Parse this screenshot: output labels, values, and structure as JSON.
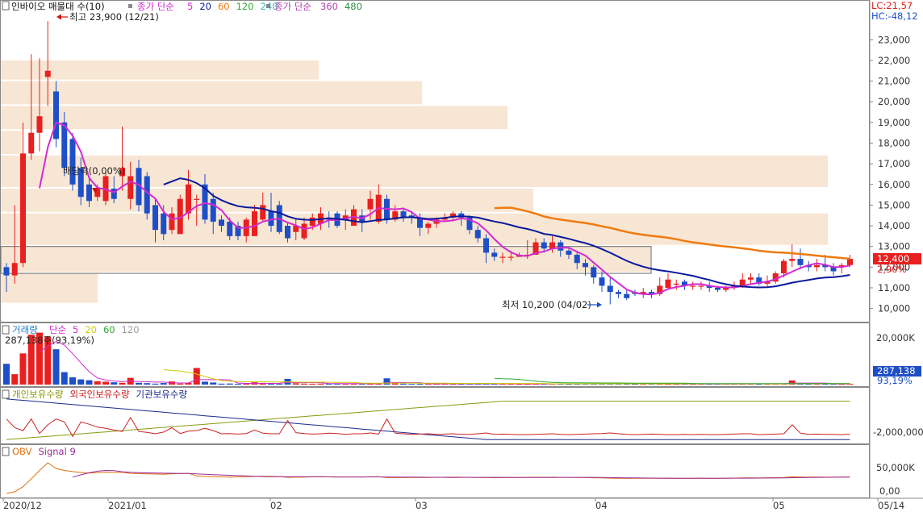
{
  "colors": {
    "up": "#e8201f",
    "down": "#1e4fc8",
    "ma5": "#d22ad2",
    "ma20": "#0a1a9c",
    "ma60": "#f07a10",
    "ma120": "#88bb22",
    "band": "#f7e6d3",
    "grid": "#aaaaaa",
    "axisText": "#333333"
  },
  "header": {
    "instrument": "인바이오 매물대 수(10)",
    "ma_label": "종가 단순",
    "ma_periods": [
      "5",
      "20",
      "60",
      "120",
      "240"
    ],
    "ma_colors": [
      "#d22ad2",
      "#0a1a9c",
      "#f07a10",
      "#33aa33",
      "#33bbbb"
    ],
    "ma2_label": "종가 단순",
    "ma2_periods": [
      "360",
      "480"
    ],
    "ma2_colors": [
      "#b040b0",
      "#2f8f4f"
    ]
  },
  "indicators": {
    "lc": "LC:21,57",
    "hc": "HC:-48,12"
  },
  "annotations": {
    "high": "최고 23,900 (12/21)",
    "low": "최저 10,200 (04/02)",
    "dividend": "배당락(0,00%)",
    "price_tag": "12,400",
    "pct_tag": "2,90%"
  },
  "volume": {
    "title": "거래량",
    "ma_label": "단순",
    "ma_periods": [
      "5",
      "20",
      "60",
      "120"
    ],
    "ma_colors": [
      "#d22ad2",
      "#cccc00",
      "#33aa33",
      "#999999"
    ],
    "summary": "287,138주(93,19%)",
    "tag_value": "287,138",
    "tag_pct": "93,19%",
    "axis_label": "20,000K"
  },
  "holdings": {
    "legend": [
      {
        "label": "개인보유수량",
        "color": "#8a9a10"
      },
      {
        "label": "외국인보유수량",
        "color": "#cc2222"
      },
      {
        "label": "기관보유수량",
        "color": "#1a2a8a"
      }
    ],
    "axis_label": "-2,000,000"
  },
  "obv": {
    "legend": [
      {
        "label": "OBV",
        "color": "#e07010"
      },
      {
        "label": "Signal 9",
        "color": "#9a2a9a"
      }
    ],
    "axis_labels": [
      "50,000K",
      "0,00"
    ]
  },
  "x_axis": {
    "labels": [
      "2020/12",
      "2021/01",
      "02",
      "03",
      "04",
      "05",
      "05/14"
    ]
  },
  "chart_data": {
    "type": "candlestick",
    "title": "인바이오",
    "y_ticks": [
      10000,
      11000,
      12000,
      13000,
      14000,
      15000,
      16000,
      17000,
      18000,
      19000,
      20000,
      21000,
      22000,
      23000
    ],
    "y_tick_labels": [
      "10,000",
      "11,000",
      "12,000",
      "13,000",
      "14,000",
      "15,000",
      "16,000",
      "17,000",
      "18,000",
      "19,000",
      "20,000",
      "21,000",
      "22,000",
      "23,000"
    ],
    "ylim": [
      9400,
      24300
    ],
    "dates": [
      "12/14",
      "12/15",
      "12/16",
      "12/17",
      "12/18",
      "12/21",
      "12/22",
      "12/23",
      "12/24",
      "12/28",
      "12/29",
      "12/30",
      "01/04",
      "01/05",
      "01/06",
      "01/07",
      "01/08",
      "01/11",
      "01/12",
      "01/13",
      "01/14",
      "01/15",
      "01/18",
      "01/19",
      "01/20",
      "01/21",
      "01/22",
      "01/25",
      "01/26",
      "01/27",
      "01/28",
      "01/29",
      "02/01",
      "02/02",
      "02/03",
      "02/04",
      "02/05",
      "02/08",
      "02/09",
      "02/10",
      "02/15",
      "02/16",
      "02/17",
      "02/18",
      "02/19",
      "02/22",
      "02/23",
      "02/24",
      "02/25",
      "02/26",
      "03/02",
      "03/03",
      "03/04",
      "03/05",
      "03/08",
      "03/09",
      "03/10",
      "03/11",
      "03/12",
      "03/15",
      "03/16",
      "03/17",
      "03/18",
      "03/19",
      "03/22",
      "03/23",
      "03/24",
      "03/25",
      "03/26",
      "03/29",
      "03/30",
      "03/31",
      "04/01",
      "04/02",
      "04/05",
      "04/06",
      "04/07",
      "04/08",
      "04/09",
      "04/12",
      "04/13",
      "04/14",
      "04/15",
      "04/16",
      "04/19",
      "04/20",
      "04/21",
      "04/22",
      "04/23",
      "04/26",
      "04/27",
      "04/28",
      "04/29",
      "04/30",
      "05/03",
      "05/04",
      "05/06",
      "05/07",
      "05/10",
      "05/11",
      "05/12",
      "05/13",
      "05/14"
    ],
    "open": [
      12000,
      11600,
      12200,
      17500,
      18500,
      21200,
      20500,
      19000,
      18200,
      16800,
      16000,
      15400,
      15200,
      15800,
      16400,
      15300,
      16800,
      16400,
      15000,
      14600,
      13800,
      13600,
      14600,
      15300,
      16000,
      15300,
      14300,
      14200,
      14000,
      13500,
      13500,
      14300,
      14700,
      15000,
      14000,
      13700,
      13400,
      14000,
      14100,
      14400,
      14600,
      14300,
      14000,
      14500,
      14800,
      14200,
      15300,
      14300,
      14700,
      14500,
      14400,
      13900,
      14100,
      14300,
      14400,
      14600,
      14400,
      13800,
      13400,
      12700,
      12500,
      12500,
      12500,
      12600,
      12600,
      13200,
      12900,
      13200,
      12800,
      12600,
      12200,
      12000,
      11500,
      11100,
      10800,
      10700,
      10800,
      10700,
      10800,
      10700,
      11000,
      11200,
      11300,
      11100,
      11100,
      11100,
      11000,
      10900,
      11000,
      11100,
      11400,
      11500,
      11200,
      11300,
      11700,
      12300,
      12400,
      12100,
      12000,
      12100,
      12000,
      12000,
      12100
    ],
    "close": [
      11600,
      12200,
      17500,
      18500,
      19300,
      21500,
      18200,
      16800,
      16000,
      15400,
      15200,
      15800,
      16400,
      15300,
      16800,
      16400,
      15000,
      14600,
      13800,
      13600,
      14600,
      15300,
      16000,
      15300,
      14300,
      14200,
      14000,
      13500,
      13500,
      14300,
      14700,
      15000,
      14000,
      13700,
      13400,
      14000,
      14100,
      14400,
      14600,
      14300,
      14000,
      14500,
      14800,
      14200,
      15300,
      15500,
      14300,
      14700,
      14400,
      14400,
      13900,
      14100,
      14300,
      14400,
      14600,
      14400,
      13800,
      13400,
      12700,
      12500,
      12500,
      12500,
      12600,
      12600,
      13200,
      12900,
      13200,
      12800,
      12600,
      12200,
      12000,
      11500,
      11100,
      10800,
      10700,
      10500,
      10700,
      10800,
      10700,
      11100,
      11400,
      11200,
      11100,
      11100,
      11100,
      11000,
      10900,
      11000,
      11100,
      11400,
      11500,
      11200,
      11300,
      11700,
      12300,
      12400,
      12100,
      12000,
      12100,
      12000,
      11800,
      12100,
      12400
    ],
    "high": [
      12200,
      15000,
      19000,
      22300,
      22100,
      23900,
      21000,
      19500,
      18500,
      17300,
      16400,
      16000,
      16600,
      16400,
      18800,
      17100,
      17200,
      16600,
      15300,
      15000,
      14900,
      15500,
      16700,
      15500,
      16500,
      15600,
      14500,
      14400,
      14200,
      14400,
      15000,
      15600,
      15600,
      15200,
      14200,
      14300,
      14400,
      14600,
      14900,
      14700,
      14700,
      14800,
      15000,
      14800,
      15700,
      16000,
      15500,
      15000,
      14800,
      14700,
      14600,
      14200,
      14400,
      14600,
      14700,
      14700,
      14500,
      14000,
      13600,
      12900,
      12700,
      12800,
      12700,
      13300,
      13400,
      13400,
      13500,
      13300,
      12900,
      12800,
      12400,
      12100,
      11800,
      11500,
      10900,
      10900,
      10900,
      11000,
      10900,
      11500,
      11700,
      11400,
      11400,
      11300,
      11300,
      11300,
      11100,
      11100,
      11300,
      11700,
      11700,
      11700,
      11600,
      11800,
      12400,
      13100,
      12900,
      12300,
      12400,
      12600,
      12200,
      12200,
      12600
    ],
    "low": [
      10800,
      11200,
      12000,
      17200,
      17600,
      19800,
      17800,
      16400,
      15700,
      15000,
      14900,
      15200,
      15000,
      15100,
      15700,
      14800,
      14700,
      14300,
      13200,
      13300,
      13600,
      14800,
      14300,
      14000,
      14100,
      13600,
      13700,
      13300,
      13300,
      13200,
      14500,
      14200,
      13700,
      13600,
      13200,
      13300,
      13300,
      13800,
      13800,
      13900,
      13900,
      13800,
      14300,
      13700,
      14300,
      14100,
      14100,
      14200,
      14200,
      14100,
      13500,
      13600,
      13900,
      14200,
      14300,
      14000,
      13600,
      13200,
      12200,
      12300,
      12200,
      12300,
      12500,
      12400,
      12600,
      12700,
      12700,
      12500,
      12400,
      11900,
      11600,
      11200,
      10800,
      10200,
      10500,
      10400,
      10600,
      10500,
      10500,
      10600,
      10900,
      10900,
      10900,
      10900,
      10900,
      10800,
      10800,
      10800,
      10900,
      11000,
      11200,
      11100,
      11000,
      11200,
      11500,
      12000,
      11900,
      11800,
      11800,
      11800,
      11600,
      11700,
      12000
    ],
    "volume": [
      20000,
      10000,
      30000,
      48000,
      50000,
      46000,
      34000,
      12000,
      7000,
      5000,
      4200,
      3200,
      2800,
      2200,
      1700,
      6500,
      1700,
      1400,
      900,
      1500,
      3000,
      1000,
      1800,
      16000,
      2800,
      2000,
      900,
      1000,
      800,
      1000,
      2200,
      1100,
      900,
      900,
      5500,
      1300,
      1000,
      800,
      900,
      1100,
      1000,
      700,
      900,
      900,
      1200,
      800,
      6000,
      1100,
      900,
      700,
      800,
      900,
      700,
      800,
      900,
      700,
      700,
      900,
      1200,
      700,
      800,
      700,
      600,
      600,
      700,
      800,
      900,
      700,
      600,
      700,
      800,
      900,
      1000,
      1200,
      900,
      700,
      600,
      700,
      800,
      700,
      600,
      600,
      700,
      600,
      700,
      600,
      600,
      700,
      800,
      900,
      900,
      600,
      700,
      800,
      900,
      4000,
      1100,
      700,
      800,
      700,
      700,
      600,
      800
    ]
  }
}
